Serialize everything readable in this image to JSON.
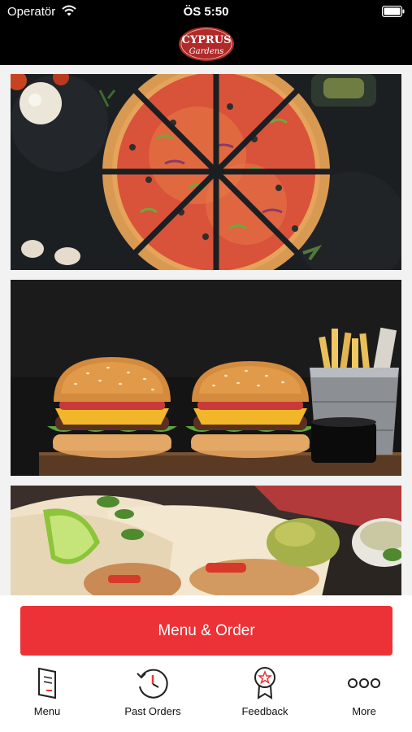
{
  "status_bar": {
    "carrier": "Operatör",
    "time": "ÖS 5:50",
    "wifi_icon": "wifi-icon",
    "battery_icon": "battery-icon"
  },
  "header": {
    "logo_main": "CYPRUS",
    "logo_sub": "Gardens",
    "logo_color": "#b02a2a"
  },
  "content": {
    "tiles": [
      {
        "subject": "pizza"
      },
      {
        "subject": "burgers and fries"
      },
      {
        "subject": "wraps"
      }
    ]
  },
  "cta": {
    "label": "Menu & Order",
    "color": "#ed3237"
  },
  "tab_bar": {
    "items": [
      {
        "label": "Menu",
        "icon": "menu-book-icon"
      },
      {
        "label": "Past Orders",
        "icon": "history-clock-icon"
      },
      {
        "label": "Feedback",
        "icon": "award-badge-icon"
      },
      {
        "label": "More",
        "icon": "more-dots-icon"
      }
    ]
  }
}
